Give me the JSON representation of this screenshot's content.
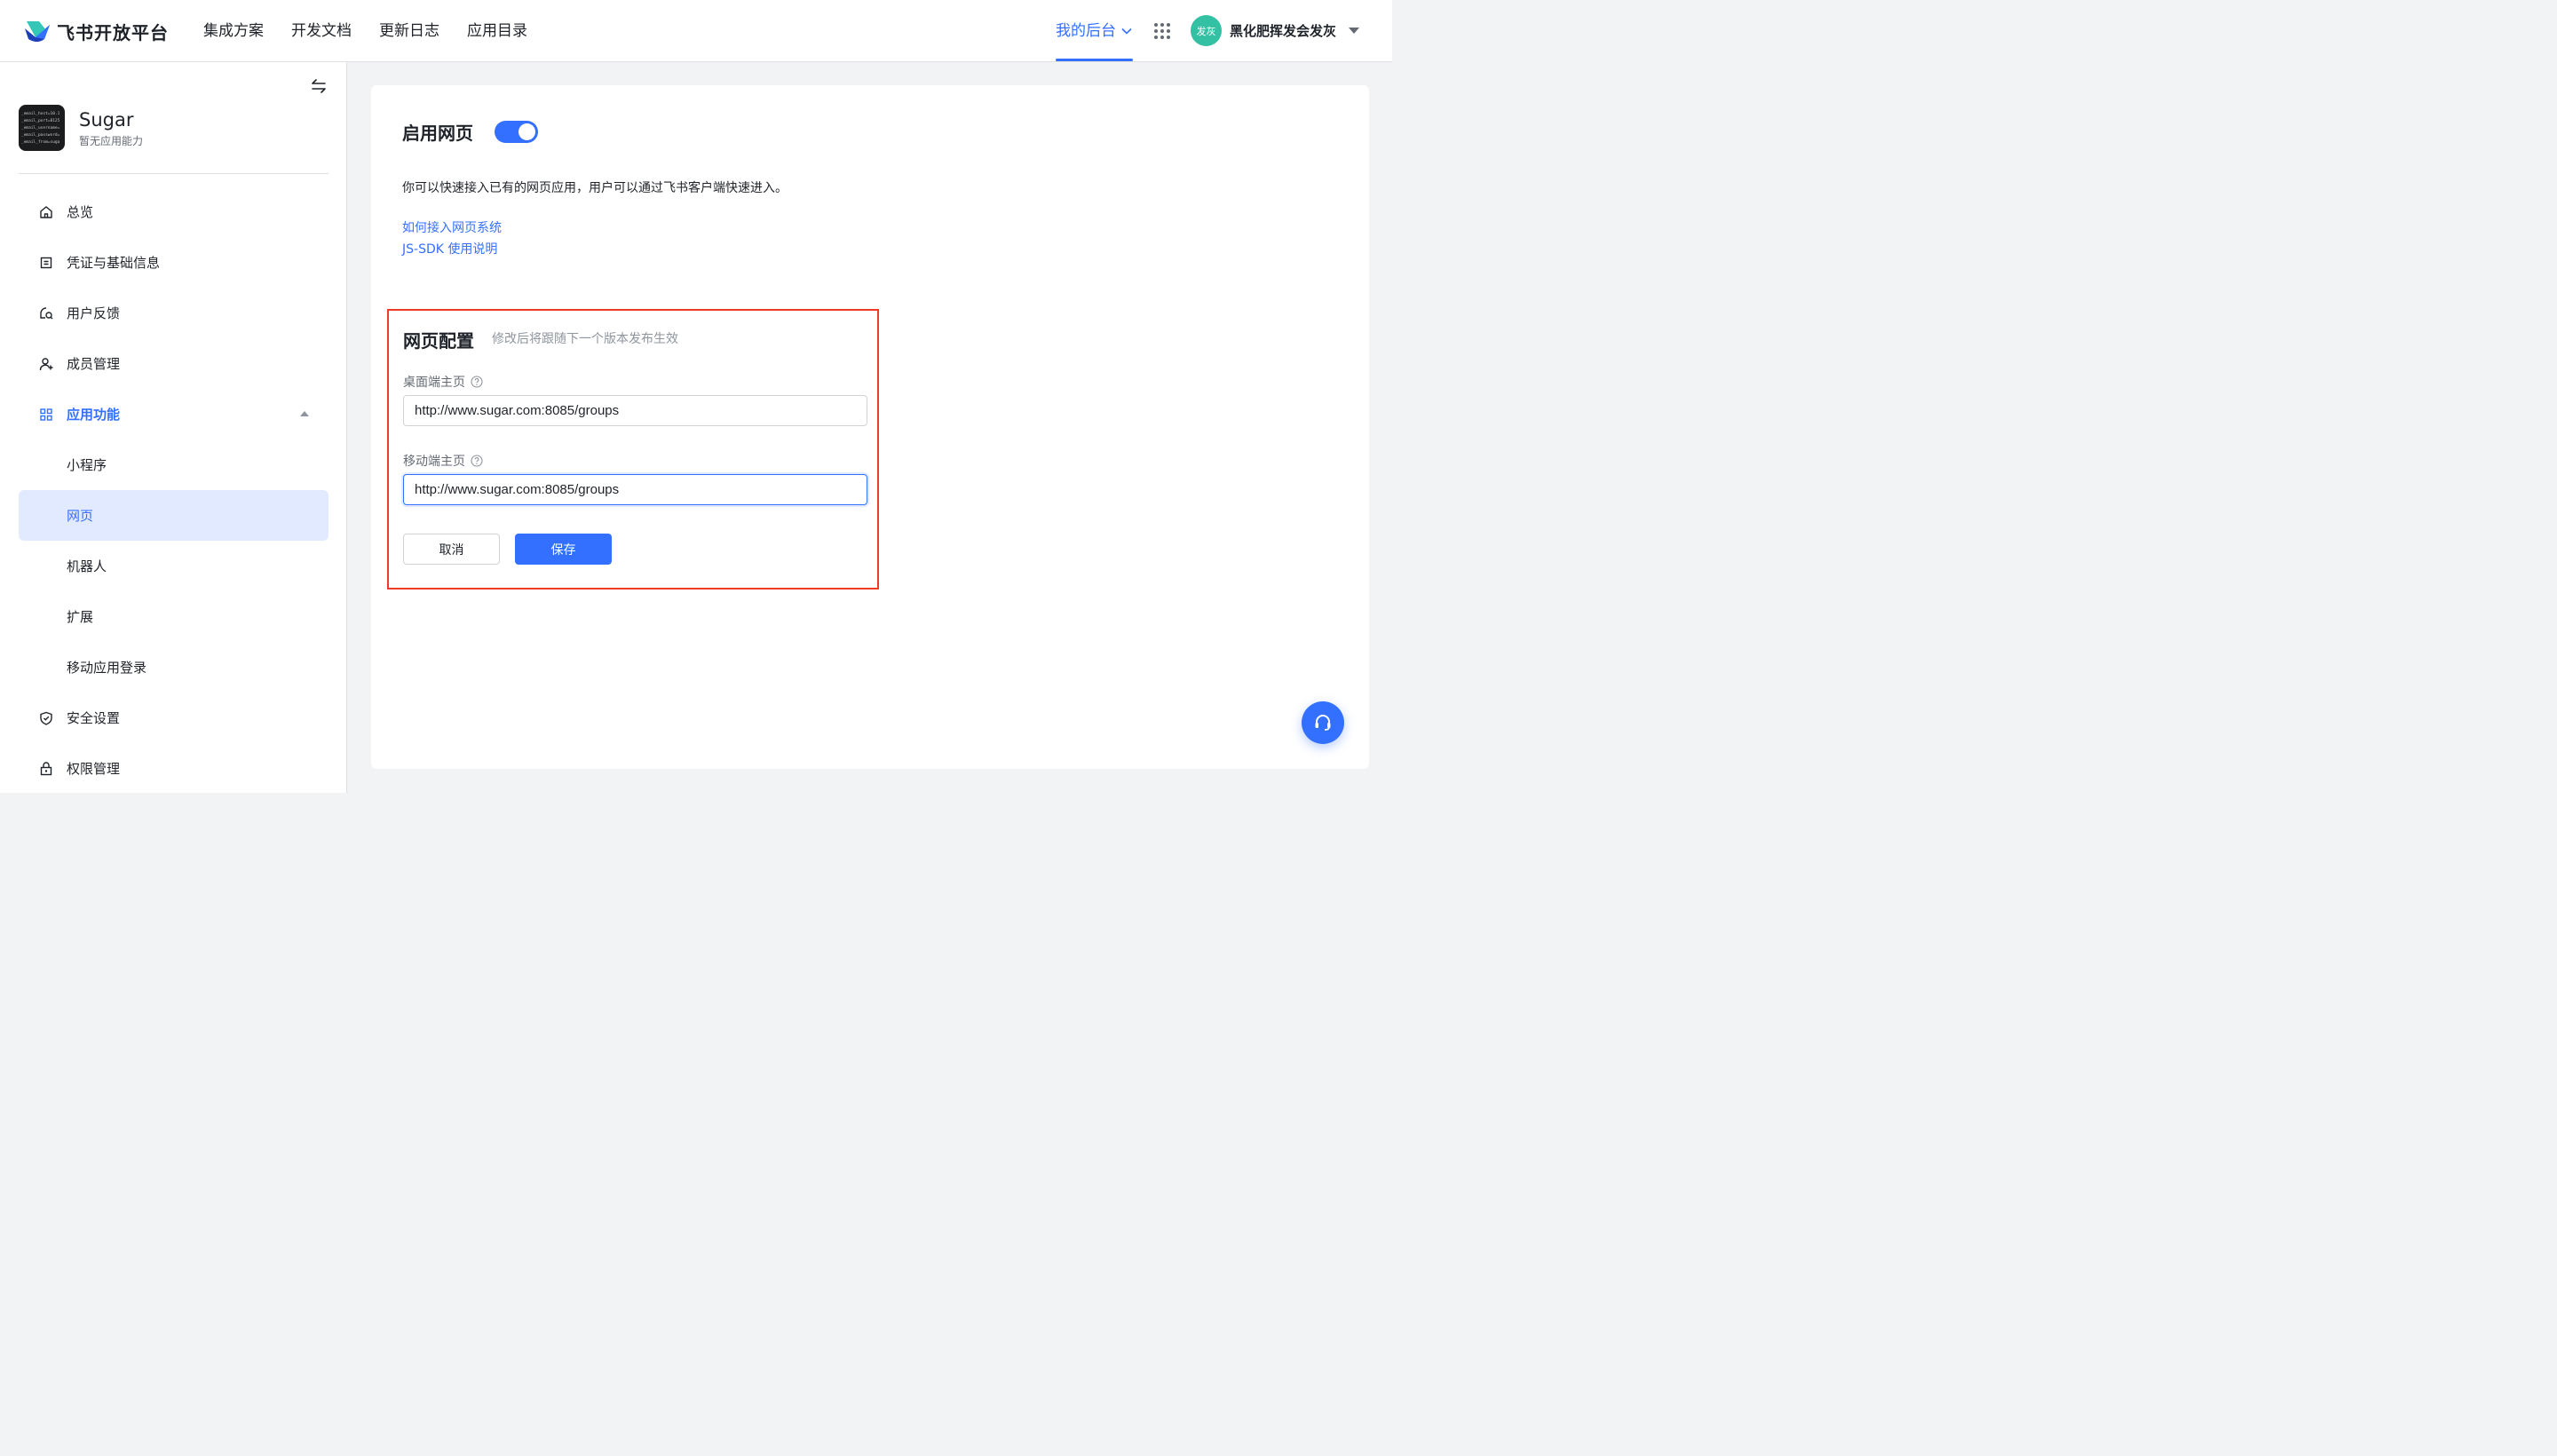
{
  "header": {
    "brand": "飞书开放平台",
    "nav": [
      "集成方案",
      "开发文档",
      "更新日志",
      "应用目录"
    ],
    "backend_label": "我的后台",
    "user": {
      "avatar_text": "发灰",
      "name": "黑化肥挥发会发灰"
    }
  },
  "sidebar": {
    "app": {
      "name": "Sugar",
      "subtitle": "暂无应用能力",
      "logo_lines": [
        "_email_host=10.1",
        "_email_port=8125",
        "_email_username=",
        "_email_password=",
        "_email_from=suga"
      ]
    },
    "items": [
      {
        "label": "总览",
        "icon": "home-icon"
      },
      {
        "label": "凭证与基础信息",
        "icon": "credential-icon"
      },
      {
        "label": "用户反馈",
        "icon": "feedback-icon"
      },
      {
        "label": "成员管理",
        "icon": "member-icon"
      },
      {
        "label": "应用功能",
        "icon": "grid-icon"
      },
      {
        "label": "小程序"
      },
      {
        "label": "网页"
      },
      {
        "label": "机器人"
      },
      {
        "label": "扩展"
      },
      {
        "label": "移动应用登录"
      },
      {
        "label": "安全设置",
        "icon": "shield-icon"
      },
      {
        "label": "权限管理",
        "icon": "lock-icon"
      }
    ]
  },
  "main": {
    "title": "启用网页",
    "toggle_on": true,
    "description": "你可以快速接入已有的网页应用，用户可以通过飞书客户端快速进入。",
    "links": [
      "如何接入网页系统",
      "JS-SDK 使用说明"
    ],
    "config": {
      "title": "网页配置",
      "hint": "修改后将跟随下一个版本发布生效",
      "desktop_label": "桌面端主页",
      "desktop_value": "http://www.sugar.com:8085/groups",
      "mobile_label": "移动端主页",
      "mobile_value": "http://www.sugar.com:8085/groups",
      "cancel_label": "取消",
      "save_label": "保存"
    }
  },
  "colors": {
    "accent": "#3370ff",
    "highlight_border": "#ef3a25",
    "active_bg": "#e1eaff"
  }
}
